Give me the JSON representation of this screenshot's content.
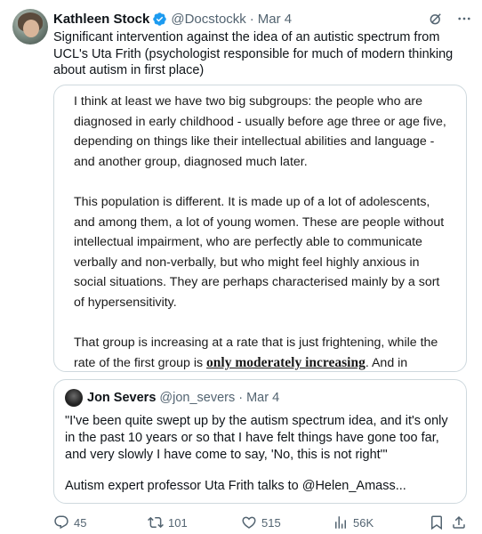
{
  "author": {
    "name": "Kathleen Stock",
    "handle": "@Docstockk",
    "separator": "·",
    "date": "Mar 4"
  },
  "tweet": {
    "text": "Significant intervention against the idea of an autistic spectrum from UCL's Uta Frith (psychologist responsible for much of modern thinking about autism in first place)"
  },
  "media": {
    "paragraph1": "I think at least we have two big subgroups: the people who are diagnosed in early childhood - usually before age three or age five, depending on things like their intellectual abilities and language - and another group, diagnosed much later.",
    "paragraph2": "This population is different. It is made up of a lot of adolescents, and among them, a lot of young women. These are people without intellectual impairment, who are perfectly able to communicate verbally and non-verbally, but who might feel highly anxious in social situations. They are perhaps characterised mainly by a sort of hypersensitivity.",
    "paragraph3_start": "That group is increasing at a rate that is just frightening, while the rate of the first group is ",
    "paragraph3_emphasis": "only moderately increasing",
    "paragraph3_end": ". And in"
  },
  "quote": {
    "name": "Jon Severs",
    "handle": "@jon_severs",
    "separator": "·",
    "date": "Mar 4",
    "text": "\"I've been quite swept up by the autism spectrum idea, and it's only in the past 10 years or so that I have felt things have gone too far, and very slowly I have come to say, 'No, this is not right'\"",
    "link_text": "Autism expert professor Uta Frith talks to @Helen_Amass..."
  },
  "actions": {
    "replies": "45",
    "reposts": "101",
    "likes": "515",
    "views": "56K"
  },
  "colors": {
    "verified": "#1d9bf0",
    "secondary_text": "#536471",
    "border": "#cfd9de"
  }
}
